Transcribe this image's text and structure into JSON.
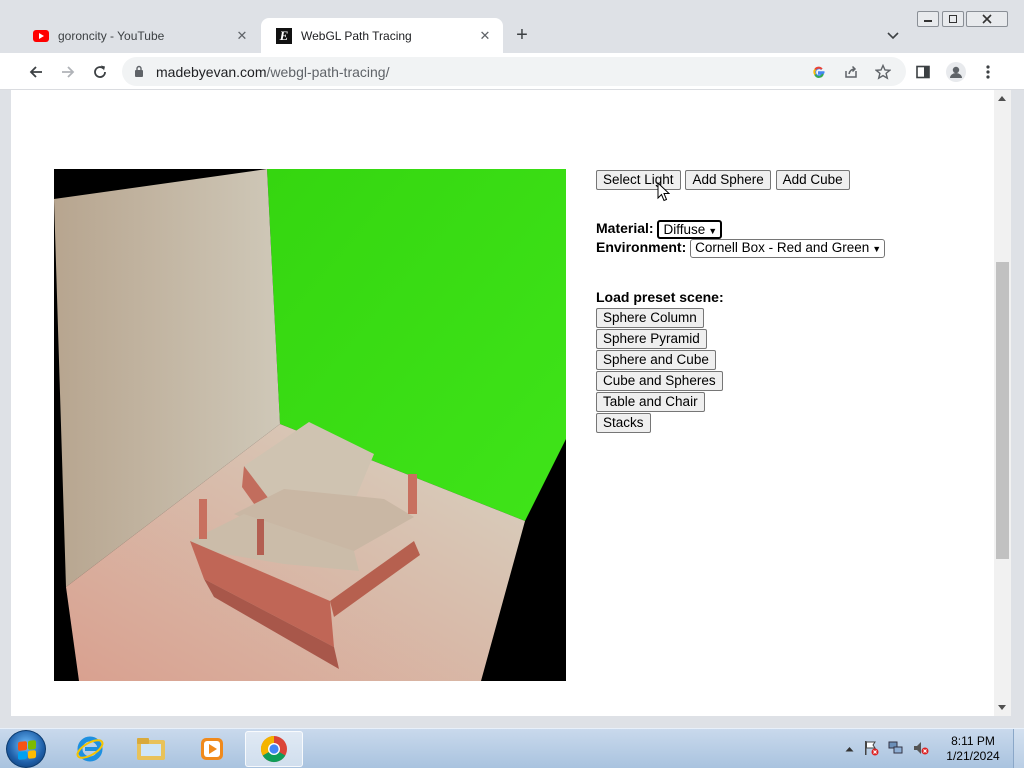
{
  "browser": {
    "tabs": [
      {
        "title": "goroncity - YouTube",
        "favicon": "youtube-icon",
        "active": false
      },
      {
        "title": "WebGL Path Tracing",
        "favicon": "evan-e-icon",
        "active": true
      }
    ],
    "url_host": "madebyevan.com",
    "url_path": "/webgl-path-tracing/"
  },
  "page": {
    "buttons_top": [
      "Select Light",
      "Add Sphere",
      "Add Cube"
    ],
    "material_label": "Material:",
    "material_value": "Diffuse",
    "environment_label": "Environment:",
    "environment_value": "Cornell Box - Red and Green",
    "preset_label": "Load preset scene:",
    "presets": [
      "Sphere Column",
      "Sphere Pyramid",
      "Sphere and Cube",
      "Cube and Spheres",
      "Table and Chair",
      "Stacks"
    ]
  },
  "taskbar": {
    "apps": [
      "internet-explorer-icon",
      "file-explorer-icon",
      "media-player-icon",
      "chrome-icon"
    ],
    "active_app": "chrome-icon",
    "clock_time": "8:11 PM",
    "clock_date": "1/21/2024"
  },
  "colors": {
    "green_wall": "#36d812",
    "accent": "#1a73e8"
  }
}
